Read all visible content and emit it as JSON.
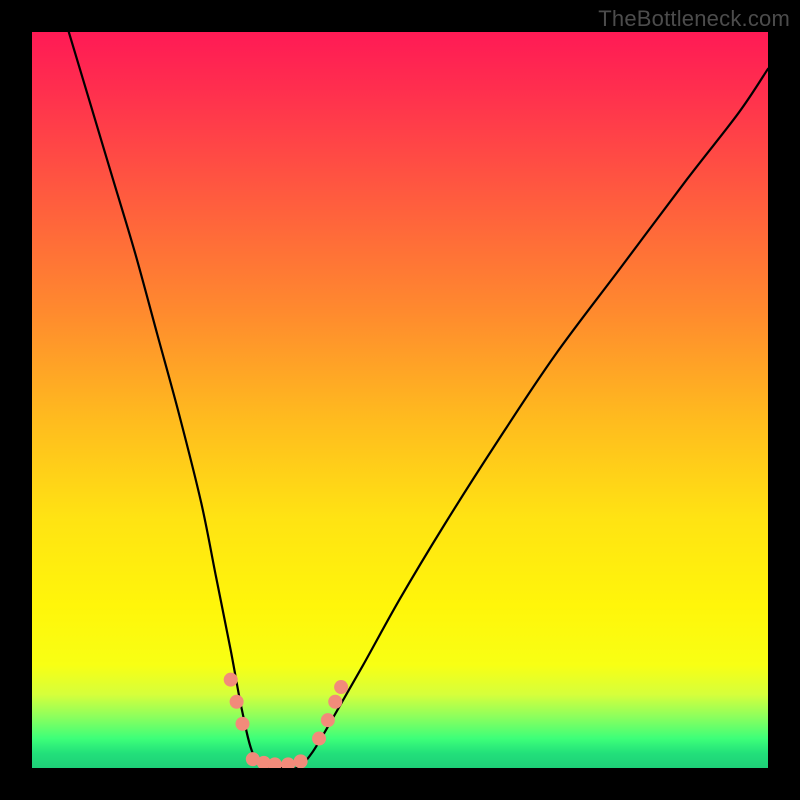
{
  "watermark": {
    "text": "TheBottleneck.com"
  },
  "chart_data": {
    "type": "line",
    "title": "",
    "xlabel": "",
    "ylabel": "",
    "xlim": [
      0,
      100
    ],
    "ylim": [
      0,
      100
    ],
    "background_gradient": {
      "direction": "vertical",
      "stops": [
        {
          "pos": 0.0,
          "color": "#ff1a55"
        },
        {
          "pos": 0.22,
          "color": "#ff5a3f"
        },
        {
          "pos": 0.52,
          "color": "#ffb91f"
        },
        {
          "pos": 0.78,
          "color": "#fff60a"
        },
        {
          "pos": 0.9,
          "color": "#d6ff3b"
        },
        {
          "pos": 0.96,
          "color": "#3dff79"
        },
        {
          "pos": 1.0,
          "color": "#1ecf78"
        }
      ]
    },
    "series": [
      {
        "name": "bottleneck-v-curve",
        "stroke": "#000000",
        "stroke_width": 2.2,
        "x": [
          5,
          8,
          11,
          14,
          17,
          20,
          23,
          25,
          27,
          28.5,
          30,
          32,
          34,
          36,
          38,
          41,
          45,
          50,
          56,
          63,
          71,
          80,
          89,
          96,
          100
        ],
        "y": [
          100,
          90,
          80,
          70,
          59,
          48,
          36,
          26,
          16,
          8,
          2,
          0,
          0,
          0,
          2,
          7,
          14,
          23,
          33,
          44,
          56,
          68,
          80,
          89,
          95
        ]
      }
    ],
    "markers": [
      {
        "name": "left-descent-dots",
        "color": "#f28b7a",
        "radius": 7,
        "points": [
          {
            "x": 27.0,
            "y": 12.0
          },
          {
            "x": 27.8,
            "y": 9.0
          },
          {
            "x": 28.6,
            "y": 6.0
          }
        ]
      },
      {
        "name": "valley-dots",
        "color": "#f28b7a",
        "radius": 7,
        "points": [
          {
            "x": 30.0,
            "y": 1.2
          },
          {
            "x": 31.5,
            "y": 0.7
          },
          {
            "x": 33.0,
            "y": 0.5
          },
          {
            "x": 34.8,
            "y": 0.5
          },
          {
            "x": 36.5,
            "y": 0.9
          }
        ]
      },
      {
        "name": "right-ascent-dots",
        "color": "#f28b7a",
        "radius": 7,
        "points": [
          {
            "x": 39.0,
            "y": 4.0
          },
          {
            "x": 40.2,
            "y": 6.5
          },
          {
            "x": 41.2,
            "y": 9.0
          },
          {
            "x": 42.0,
            "y": 11.0
          }
        ]
      }
    ]
  }
}
